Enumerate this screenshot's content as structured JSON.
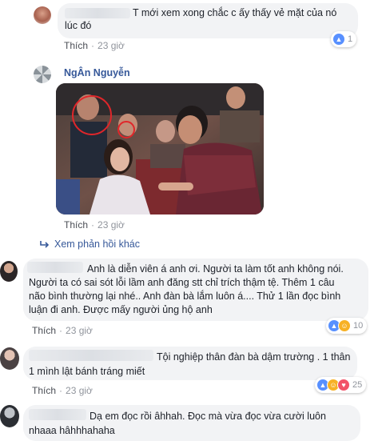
{
  "comments": [
    {
      "text_lines": [
        "T mới xem xong chắc c ấy thấy vẻ mặt của nó",
        "lúc đó"
      ],
      "like_label": "Thích",
      "time": "23 giờ",
      "reaction_count": "1",
      "reactions": [
        "like"
      ]
    },
    {
      "author": "NgÂn Nguyễn",
      "like_label": "Thích",
      "time": "23 giờ"
    },
    {
      "text_lines": [
        "Anh là diễn viên á anh ơi. Người ta làm tốt anh không nói.",
        "Người ta có sai sót lỗi lầm anh đăng stt chỉ trích thậm tệ. Thêm 1 câu",
        "não bình thường lại nhé.. Anh đàn bà lắm luôn á.... Thử 1 lần đọc bình",
        "luận đi anh. Được mấy người ủng hộ anh"
      ],
      "like_label": "Thích",
      "time": "23 giờ",
      "reaction_count": "10",
      "reactions": [
        "like",
        "haha"
      ]
    },
    {
      "text_lines": [
        "Tội nghiệp thân đàn bà dậm trường . 1 thân",
        "1 mình lật bánh tráng miết"
      ],
      "like_label": "Thích",
      "time": "23 giờ",
      "reaction_count": "25",
      "reactions": [
        "like",
        "haha",
        "love"
      ]
    },
    {
      "text_lines": [
        "Dạ em đọc rồi âhhah. Đọc mà vừa đọc vừa cười luôn",
        "nhaaa hâhhhahaha"
      ]
    }
  ],
  "replies_link": "Xem phản hồi khác",
  "icons": {
    "reply": "reply-arrow-icon",
    "like": "like-icon",
    "haha": "haha-icon",
    "love": "love-icon"
  },
  "colors": {
    "link": "#365899",
    "bubble": "#f2f3f5",
    "meta": "#90949c",
    "like_blue": "#5890ff"
  }
}
